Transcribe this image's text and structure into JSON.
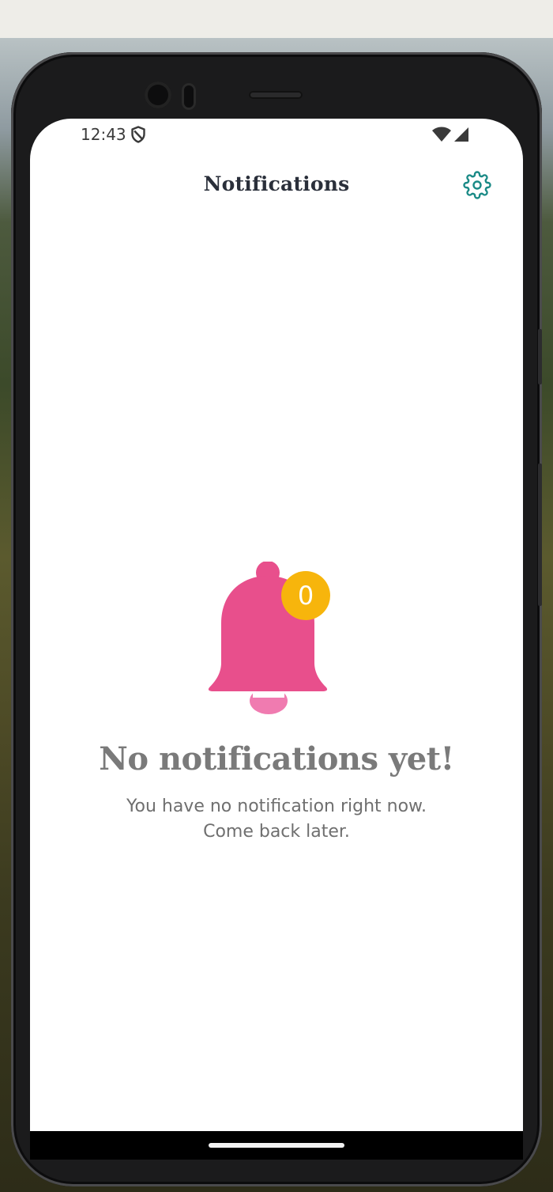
{
  "status_bar": {
    "time": "12:43",
    "icons": [
      "shield-icon",
      "wifi-icon",
      "cell-signal-icon"
    ]
  },
  "header": {
    "title": "Notifications",
    "settings_icon": "gear-icon"
  },
  "empty_state": {
    "icon": "bell-icon",
    "badge_count": "0",
    "title": "No notifications yet!",
    "subtitle_line1": "You have no notification right now.",
    "subtitle_line2": "Come back later."
  },
  "colors": {
    "accent": "#1a8a86",
    "bell": "#e84f8c",
    "bell_clapper": "#f07bb0",
    "badge": "#f7b50c",
    "title_text": "#2a2f3a",
    "muted_text": "#7a7a7a"
  }
}
